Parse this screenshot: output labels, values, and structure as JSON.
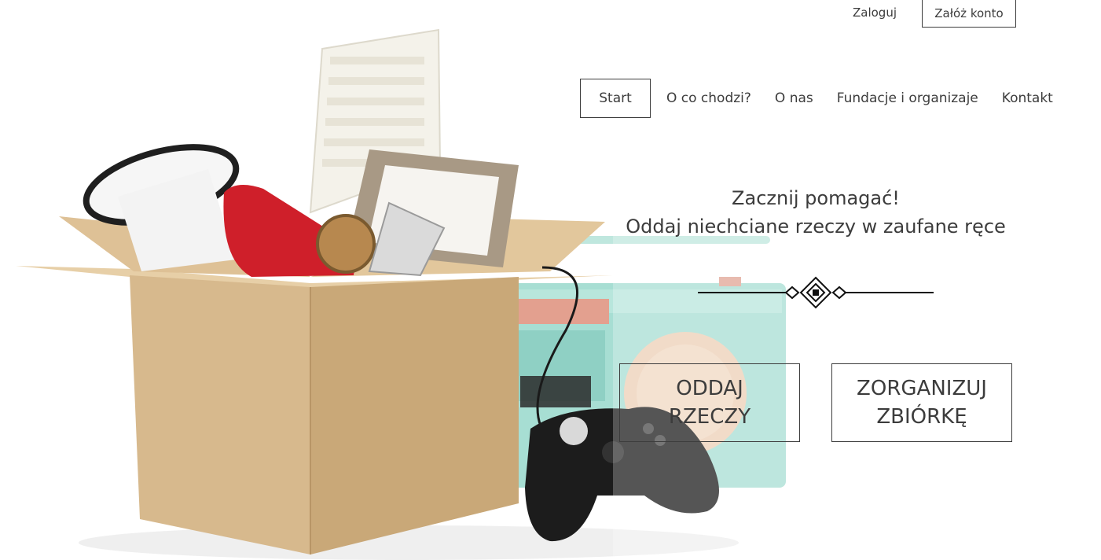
{
  "auth": {
    "login_label": "Zaloguj",
    "register_label": "Załóż konto"
  },
  "nav": {
    "items": [
      {
        "label": "Start",
        "active": true
      },
      {
        "label": "O co chodzi?"
      },
      {
        "label": "O nas"
      },
      {
        "label": "Fundacje i organizaje"
      },
      {
        "label": "Kontakt"
      }
    ]
  },
  "hero": {
    "headline_line1": "Zacznij pomagać!",
    "headline_line2": "Oddaj niechciane rzeczy w zaufane ręce",
    "cta_give": "ODDAJ RZECZY",
    "cta_organize": "ZORGANIZUJ ZBIÓRKĘ"
  },
  "colors": {
    "text": "#3c3c3c",
    "box": "#d9bc92",
    "radio": "#9edcd0",
    "phone": "#cf1f2a"
  }
}
